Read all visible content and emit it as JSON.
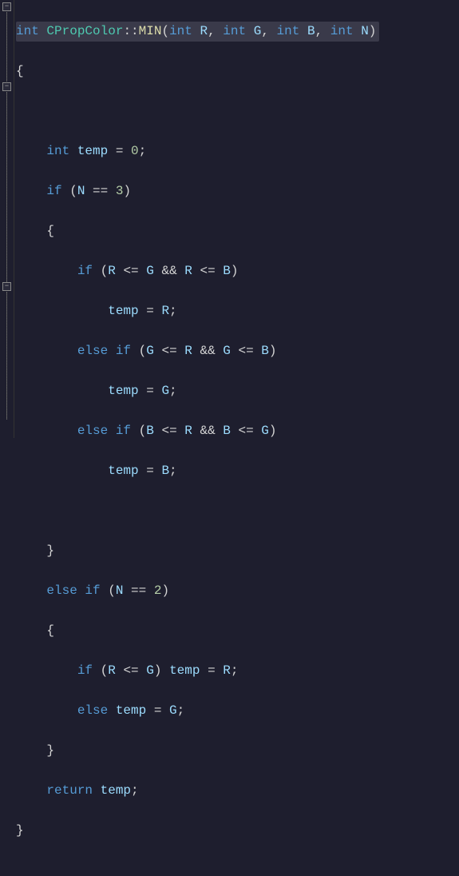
{
  "code": {
    "sig_type": "int",
    "sig_class": "CPropColor",
    "sig_sep": "::",
    "sig_fn": "MIN",
    "sig_paren_open": "(",
    "sig_p1_type": "int",
    "sig_p1_name": "R",
    "sig_c1": ", ",
    "sig_p2_type": "int",
    "sig_p2_name": "G",
    "sig_c2": ", ",
    "sig_p3_type": "int",
    "sig_p3_name": "B",
    "sig_c3": ", ",
    "sig_p4_type": "int",
    "sig_p4_name": "N",
    "sig_paren_close": ")",
    "brace_open": "{",
    "brace_close": "}",
    "decl_type": "int",
    "decl_var": "temp",
    "decl_eq": " = ",
    "decl_val": "0",
    "semi": ";",
    "kw_if": "if",
    "kw_else": "else",
    "kw_return": "return",
    "v_N": "N",
    "v_R": "R",
    "v_G": "G",
    "v_B": "B",
    "v_temp": "temp",
    "n3": "3",
    "n2": "2",
    "op_eqeq": " == ",
    "op_le": " <= ",
    "op_and": " && ",
    "op_assign": " = ",
    "paren_open": "(",
    "paren_close": ")",
    "sp": " "
  },
  "gutter": {
    "fold_minus": "−"
  }
}
